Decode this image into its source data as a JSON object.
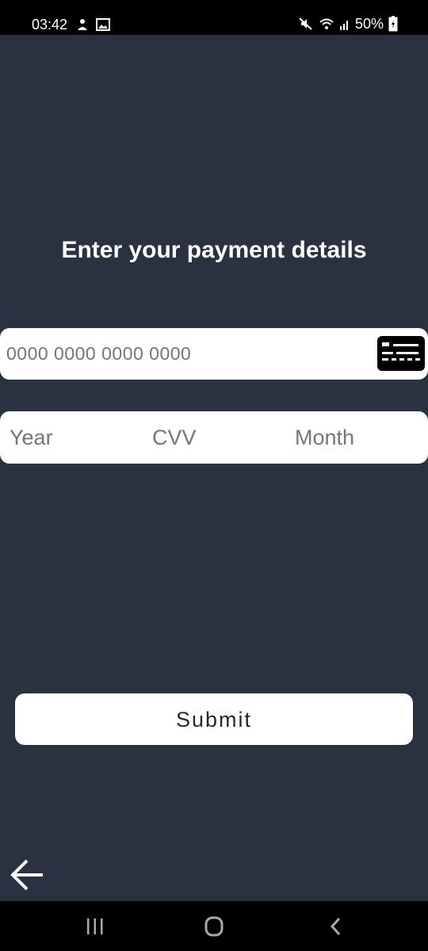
{
  "status_bar": {
    "time": "03:42",
    "battery": "50%",
    "left_icons": [
      "notification-icon",
      "image-icon"
    ],
    "right_icons": [
      "mute-icon",
      "wifi-icon",
      "signal-icon",
      "battery-icon"
    ]
  },
  "title": "Enter your payment details",
  "card": {
    "number_placeholder": "0000 0000 0000 0000",
    "icon": "credit-card-icon"
  },
  "expiry": {
    "year_placeholder": "Year",
    "cvv_placeholder": "CVV",
    "month_placeholder": "Month"
  },
  "submit_label": "Submit",
  "back_icon": "back-arrow-icon",
  "nav_bar": {
    "icons": [
      "recents-icon",
      "home-icon",
      "back-icon"
    ]
  },
  "colors": {
    "background": "#2a3241",
    "surface": "#ffffff",
    "text_dark": "#1f2735",
    "placeholder": "#555555"
  }
}
